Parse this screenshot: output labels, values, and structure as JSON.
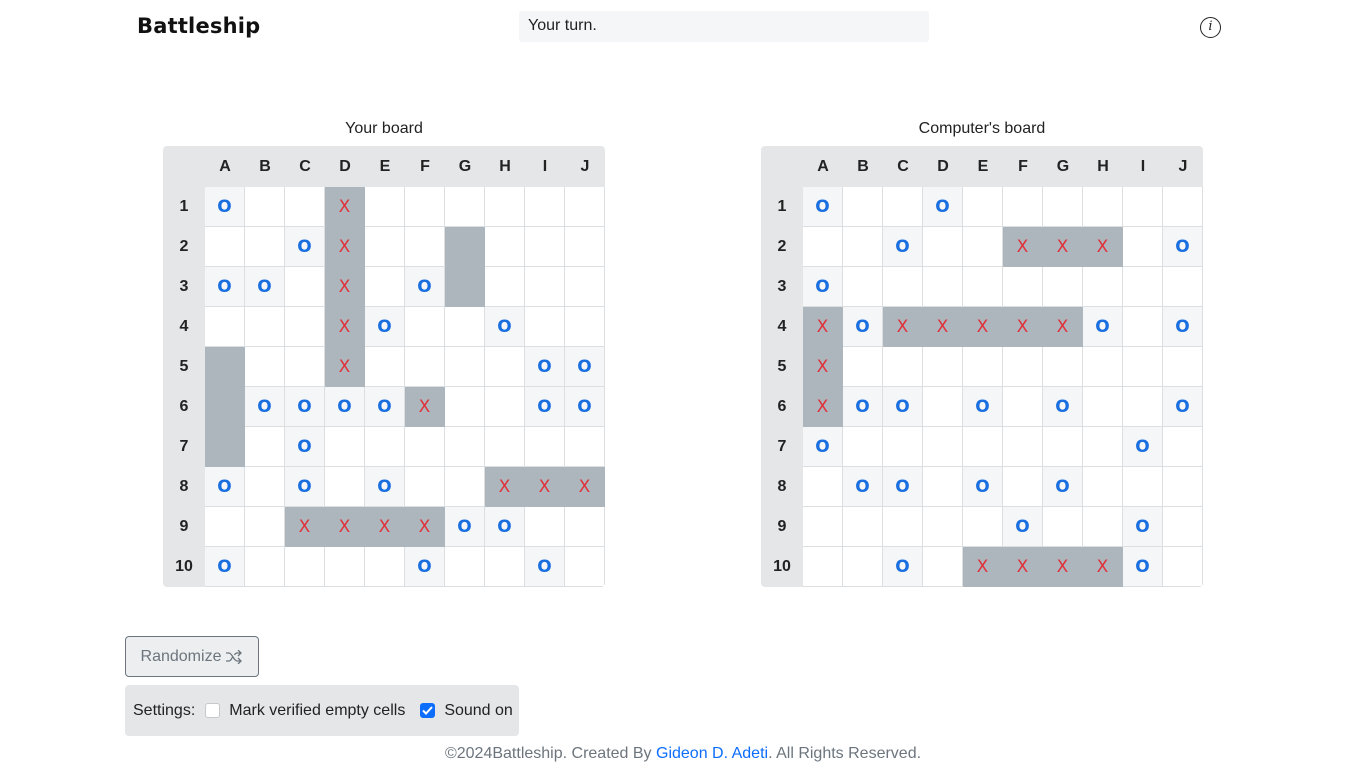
{
  "header": {
    "title": "Battleship",
    "status": "Your turn.",
    "info_icon": "info-icon"
  },
  "columns": [
    "A",
    "B",
    "C",
    "D",
    "E",
    "F",
    "G",
    "H",
    "I",
    "J"
  ],
  "rows": [
    "1",
    "2",
    "3",
    "4",
    "5",
    "6",
    "7",
    "8",
    "9",
    "10"
  ],
  "boards": [
    {
      "id": "player",
      "title": "Your board",
      "grid": [
        "m..X......",
        "..mX..S...",
        "mm.X.mS...",
        "...Xm..m..",
        "S..X....mm",
        "SmmmmX..mm",
        "S.m.......",
        "m.m.m..XXX",
        "..XXXXmm..",
        "m....m..m."
      ]
    },
    {
      "id": "computer",
      "title": "Computer's board",
      "grid": [
        "m..m......",
        "..m..XXX.m",
        "m.........",
        "XmXXXXXm.m",
        "X.........",
        "Xmm.m.m..m",
        "m.......m.",
        ".mm.m.m...",
        ".....m..m.",
        "..m.XXXXm."
      ]
    }
  ],
  "marks": {
    "miss": "O",
    "hit": "X"
  },
  "colors": {
    "ship": "#adb5bd",
    "miss": "#1a6fe0",
    "hit": "#e0303a",
    "link": "#0d6efd"
  },
  "controls": {
    "randomize_label": "Randomize",
    "randomize_icon": "shuffle-icon",
    "settings_label": "Settings:",
    "mark_empty_label": "Mark verified empty cells",
    "mark_empty_checked": false,
    "sound_label": "Sound on",
    "sound_checked": true
  },
  "footer": {
    "prefix": "©2024Battleship. Created By ",
    "author": "Gideon D. Adeti",
    "suffix": ". All Rights Reserved."
  }
}
